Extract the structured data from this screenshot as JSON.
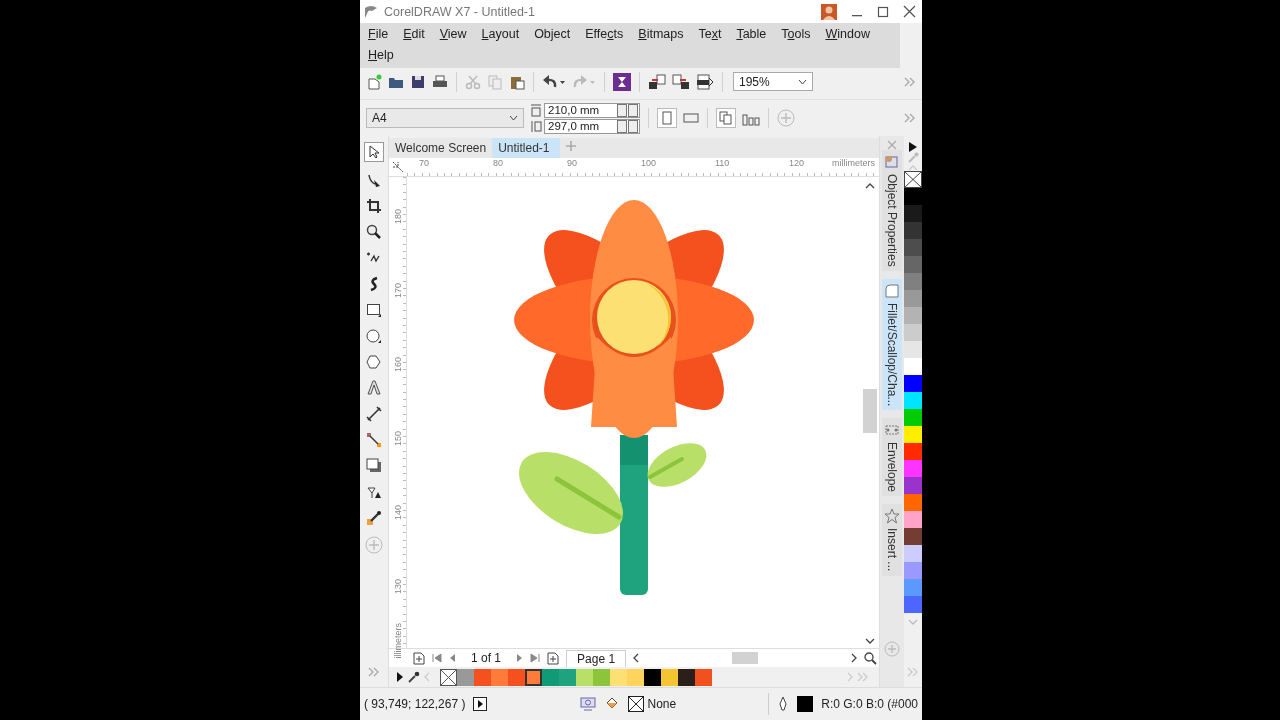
{
  "window": {
    "title": "CorelDRAW X7 - Untitled-1"
  },
  "menu": [
    {
      "label": "File"
    },
    {
      "label": "Edit"
    },
    {
      "label": "View"
    },
    {
      "label": "Layout"
    },
    {
      "label": "Object"
    },
    {
      "label": "Effects"
    },
    {
      "label": "Bitmaps"
    },
    {
      "label": "Text"
    },
    {
      "label": "Table"
    },
    {
      "label": "Tools"
    },
    {
      "label": "Window"
    },
    {
      "label": "Help"
    }
  ],
  "standard_toolbar": {
    "zoom": "195%"
  },
  "property_bar": {
    "page_size": "A4",
    "page_width": "210,0 mm",
    "page_height": "297,0 mm"
  },
  "document_tabs": [
    {
      "label": "Welcome Screen",
      "selected": false
    },
    {
      "label": "Untitled-1",
      "selected": true
    }
  ],
  "horizontal_ruler": {
    "labels": [
      "70",
      "80",
      "90",
      "100",
      "110",
      "120"
    ],
    "unit": "millimeters"
  },
  "vertical_ruler": {
    "labels": [
      "180",
      "170",
      "160",
      "150",
      "140",
      "130"
    ],
    "unit": "illimeters"
  },
  "page_navigator": {
    "count": "1 of 1",
    "page_tab": "Page 1"
  },
  "docker_tabs": [
    {
      "label": "Object Properties",
      "selected": false
    },
    {
      "label": "Fillet/Scallop/Cha...",
      "selected": true
    },
    {
      "label": "Envelope",
      "selected": false
    },
    {
      "label": "Insert ...",
      "selected": false
    }
  ],
  "color_palette": [
    {
      "kind": "none"
    },
    {
      "kind": "swatch",
      "color": "#000000"
    },
    {
      "kind": "swatch",
      "color": "#1a1a1a"
    },
    {
      "kind": "swatch",
      "color": "#333333"
    },
    {
      "kind": "swatch",
      "color": "#4d4d4d"
    },
    {
      "kind": "swatch",
      "color": "#666666"
    },
    {
      "kind": "swatch",
      "color": "#808080"
    },
    {
      "kind": "swatch",
      "color": "#999999"
    },
    {
      "kind": "swatch",
      "color": "#b3b3b3"
    },
    {
      "kind": "swatch",
      "color": "#cccccc"
    },
    {
      "kind": "swatch",
      "color": "#e6e6e6"
    },
    {
      "kind": "swatch",
      "color": "#ffffff"
    },
    {
      "kind": "swatch",
      "color": "#0000ff"
    },
    {
      "kind": "swatch",
      "color": "#00e5ff"
    },
    {
      "kind": "swatch",
      "color": "#00cc00"
    },
    {
      "kind": "swatch",
      "color": "#ffee00"
    },
    {
      "kind": "swatch",
      "color": "#ff2a00"
    },
    {
      "kind": "swatch",
      "color": "#ff33ff"
    },
    {
      "kind": "swatch",
      "color": "#9933cc"
    },
    {
      "kind": "swatch",
      "color": "#ff6600"
    },
    {
      "kind": "swatch",
      "color": "#ffa3c8"
    },
    {
      "kind": "swatch",
      "color": "#733d33"
    },
    {
      "kind": "swatch",
      "color": "#ccccff"
    },
    {
      "kind": "swatch",
      "color": "#9999ff"
    },
    {
      "kind": "swatch",
      "color": "#5c99ff"
    },
    {
      "kind": "swatch",
      "color": "#4d66ff"
    }
  ],
  "document_palette": [
    {
      "kind": "none",
      "selected": false
    },
    {
      "kind": "swatch",
      "color": "#999999",
      "selected": false
    },
    {
      "kind": "swatch",
      "color": "#f4511e",
      "selected": false
    },
    {
      "kind": "swatch",
      "color": "#ff7b3a",
      "selected": false
    },
    {
      "kind": "swatch",
      "color": "#f4511e",
      "selected": false
    },
    {
      "kind": "swatch",
      "color": "#ff7b3a",
      "selected": true
    },
    {
      "kind": "swatch",
      "color": "#109a76",
      "selected": false
    },
    {
      "kind": "swatch",
      "color": "#1fa37f",
      "selected": false
    },
    {
      "kind": "swatch",
      "color": "#b8e068",
      "selected": false
    },
    {
      "kind": "swatch",
      "color": "#8cc43c",
      "selected": false
    },
    {
      "kind": "swatch",
      "color": "#fde073",
      "selected": false
    },
    {
      "kind": "swatch",
      "color": "#ffd45c",
      "selected": false
    },
    {
      "kind": "swatch",
      "color": "#000000",
      "selected": false
    },
    {
      "kind": "swatch",
      "color": "#f5c431",
      "selected": false
    },
    {
      "kind": "swatch",
      "color": "#2b1f1a",
      "selected": false
    },
    {
      "kind": "swatch",
      "color": "#f0511e",
      "selected": false
    }
  ],
  "status_bar": {
    "coordinates": "( 93,749; 122,267 )",
    "fill": "None",
    "outline_color": "R:0 G:0 B:0 (#000"
  }
}
